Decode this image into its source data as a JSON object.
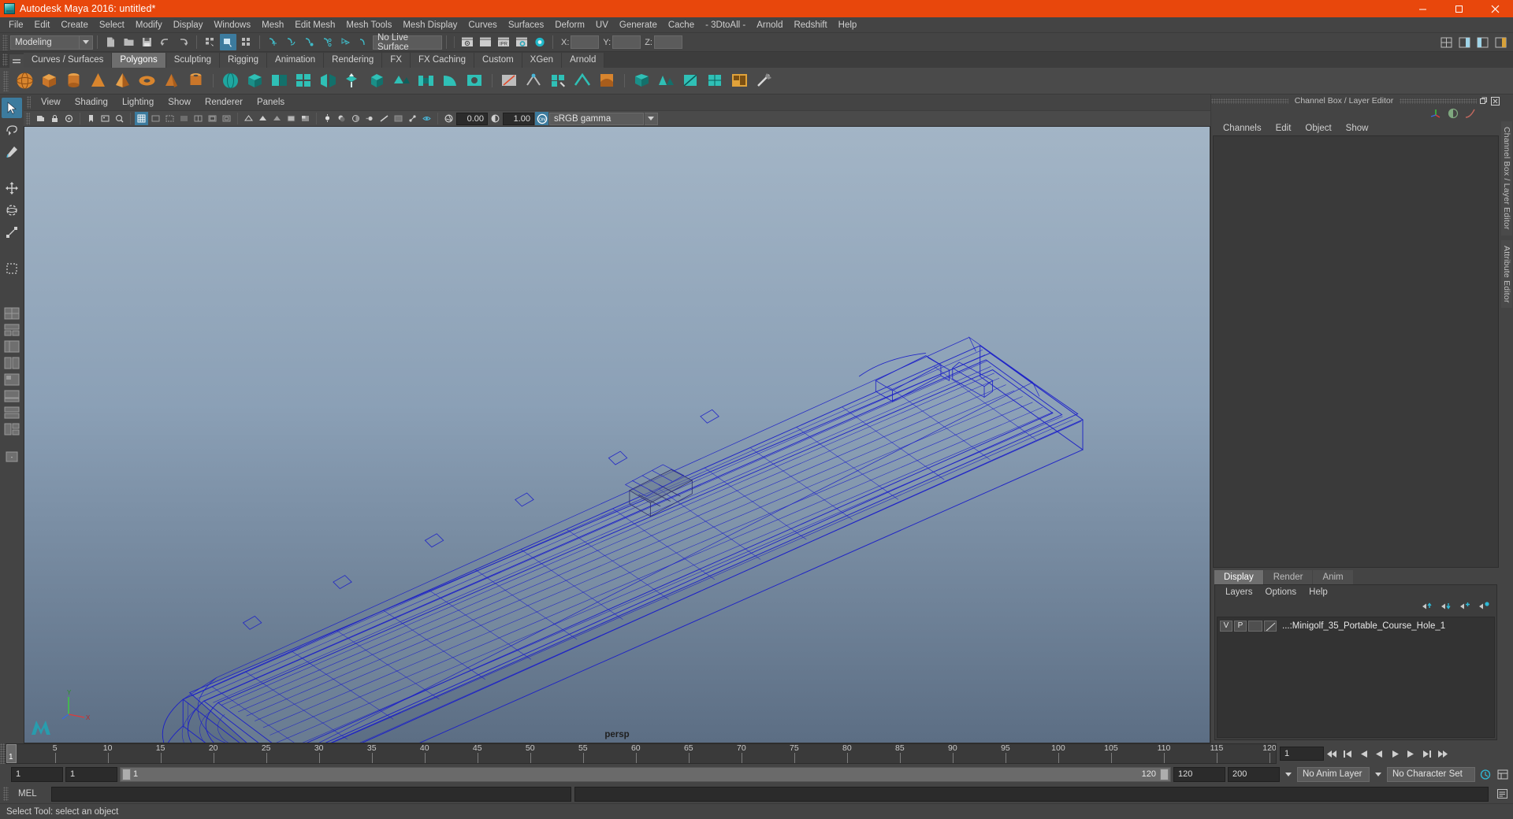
{
  "window": {
    "title": "Autodesk Maya 2016: untitled*",
    "app_icon": "maya-icon",
    "minimize": "minimize-icon",
    "maximize": "maximize-icon",
    "close": "close-icon",
    "titlebar_color": "#e8470c"
  },
  "menubar": [
    "File",
    "Edit",
    "Create",
    "Select",
    "Modify",
    "Display",
    "Windows",
    "Mesh",
    "Edit Mesh",
    "Mesh Tools",
    "Mesh Display",
    "Curves",
    "Surfaces",
    "Deform",
    "UV",
    "Generate",
    "Cache",
    "- 3DtoAll -",
    "Arnold",
    "Redshift",
    "Help"
  ],
  "statusbar": {
    "mode": "Modeling",
    "live_surface": "No Live Surface",
    "x_label": "X:",
    "y_label": "Y:",
    "z_label": "Z:",
    "x_value": "",
    "y_value": "",
    "z_value": "",
    "icons": [
      "new-scene-icon",
      "open-scene-icon",
      "save-scene-icon",
      "undo-icon",
      "redo-icon",
      "select-by-hierarchy-icon",
      "select-by-object-icon",
      "select-by-component-icon",
      "snap-to-grid-icon",
      "snap-to-curve-icon",
      "snap-to-point-icon",
      "snap-to-projected-center-icon",
      "snap-to-view-plane-icon",
      "make-live-icon",
      "render-view-icon",
      "render-sequence-icon",
      "ipr-render-icon",
      "render-settings-icon",
      "hypershade-icon",
      "show-hide-editors-icon",
      "show-hide-attribute-editor-icon",
      "show-hide-tool-settings-icon",
      "show-hide-channel-box-icon"
    ]
  },
  "shelf": {
    "tabs": [
      "Curves / Surfaces",
      "Polygons",
      "Sculpting",
      "Rigging",
      "Animation",
      "Rendering",
      "FX",
      "FX Caching",
      "Custom",
      "XGen",
      "Arnold"
    ],
    "active_tab": "Polygons",
    "icons": [
      "polygon-sphere-icon",
      "polygon-cube-icon",
      "polygon-cylinder-icon",
      "polygon-cone-icon",
      "polygon-pyramid-icon",
      "polygon-torus-icon",
      "polygon-prism-icon",
      "polygon-pipe-icon",
      "sphere-smooth-icon",
      "cube-smooth-icon",
      "combine-icon",
      "booleans-icon",
      "mirror-icon",
      "extrude-icon",
      "bevel-icon",
      "append-polygon-icon",
      "bridge-icon",
      "wedge-icon",
      "fill-hole-icon",
      "multi-cut-icon",
      "target-weld-icon",
      "quad-draw-icon",
      "crease-icon",
      "sculpt-tool-icon",
      "smooth-icon",
      "reduce-icon",
      "triangulate-icon",
      "quadrangulate-icon",
      "uv-editor-icon",
      "cleanup-icon"
    ]
  },
  "toolbox": {
    "tools": [
      "select-tool-icon",
      "lasso-select-tool-icon",
      "paint-select-tool-icon",
      "move-tool-icon",
      "rotate-tool-icon",
      "scale-tool-icon",
      "last-tool-icon",
      "show-manipulator-icon"
    ],
    "layouts": [
      "single-perspective-layout-icon",
      "four-view-layout-icon",
      "persp-outliner-layout-icon",
      "persp-graph-layout-icon",
      "hypershade-persp-layout-icon",
      "persp-trax-layout-icon",
      "two-pane-stacked-layout-icon",
      "three-pane-split-layout-icon",
      "more-layouts-icon"
    ]
  },
  "viewport": {
    "menus": [
      "View",
      "Shading",
      "Lighting",
      "Show",
      "Renderer",
      "Panels"
    ],
    "camera_label": "persp",
    "exposure_value": "0.00",
    "gamma_value": "1.00",
    "color_management": "sRGB gamma",
    "toolbar_icons": [
      "select-camera-icon",
      "lock-camera-icon",
      "camera-attributes-icon",
      "bookmark-icon",
      "image-plane-icon",
      "two-d-pan-zoom-icon",
      "grid-toggle-icon",
      "film-gate-icon",
      "resolution-gate-icon",
      "gate-mask-icon",
      "field-chart-icon",
      "safe-action-icon",
      "safe-title-icon",
      "exposure-icon",
      "gamma-icon",
      "color-management-toggle-icon",
      "wireframe-shading-icon",
      "smooth-shading-icon",
      "flat-shading-icon",
      "shaded-wireframe-icon",
      "textured-icon",
      "lights-icon",
      "shadows-icon",
      "ambient-occlusion-icon",
      "motion-blur-icon",
      "anti-alias-icon",
      "xray-icon",
      "xray-joints-icon",
      "isolate-select-icon"
    ],
    "axes": {
      "x": "X",
      "y": "Y",
      "z": "Z"
    }
  },
  "channel_box": {
    "panel_title": "Channel Box / Layer Editor",
    "menus": [
      "Channels",
      "Edit",
      "Object",
      "Show"
    ],
    "undock_icon": "undock-icon",
    "close_icon": "close-panel-icon",
    "header_icons": [
      "axis-manip-icon",
      "sphere-contrast-icon",
      "anim-curve-icon"
    ]
  },
  "layer_editor": {
    "tabs": [
      "Display",
      "Render",
      "Anim"
    ],
    "active_tab": "Display",
    "menus": [
      "Layers",
      "Options",
      "Help"
    ],
    "buttons": [
      "move-layer-up-icon",
      "move-layer-down-icon",
      "new-layer-icon",
      "new-layer-from-selected-icon"
    ],
    "layers": [
      {
        "visibility": "V",
        "playback": "P",
        "shading": "",
        "name": "...:Minigolf_35_Portable_Course_Hole_1"
      }
    ]
  },
  "side_tabs": [
    "Channel Box / Layer Editor",
    "Attribute Editor"
  ],
  "timeline": {
    "start": 1,
    "end": 120,
    "current_frame": "1",
    "ticks": [
      5,
      10,
      15,
      20,
      25,
      30,
      35,
      40,
      45,
      50,
      55,
      60,
      65,
      70,
      75,
      80,
      85,
      90,
      95,
      100,
      105,
      110,
      115,
      120
    ],
    "playback_buttons": [
      "go-to-start-icon",
      "step-back-key-icon",
      "step-back-frame-icon",
      "play-backwards-icon",
      "play-forwards-icon",
      "step-forward-frame-icon",
      "step-forward-key-icon",
      "go-to-end-icon"
    ]
  },
  "range_slider": {
    "range_start": "1",
    "anim_start": "1",
    "slider_start": "1",
    "slider_end": "120",
    "anim_end": "120",
    "range_end": "200",
    "anim_layer": "No Anim Layer",
    "character_set": "No Character Set",
    "auto_key_icon": "auto-keyframe-icon",
    "anim_prefs_icon": "animation-preferences-icon"
  },
  "command_line": {
    "label": "MEL",
    "input_value": "",
    "output_value": "",
    "script_editor_icon": "script-editor-icon"
  },
  "help_line": {
    "text": "Select Tool: select an object"
  },
  "colors": {
    "accent": "#e8470c",
    "highlight": "#3c7b9e",
    "wireframe": "#1b1fc8",
    "panel_bg": "#444444",
    "viewport_top": "#9fb2c4",
    "viewport_bottom": "#5d6f85"
  }
}
